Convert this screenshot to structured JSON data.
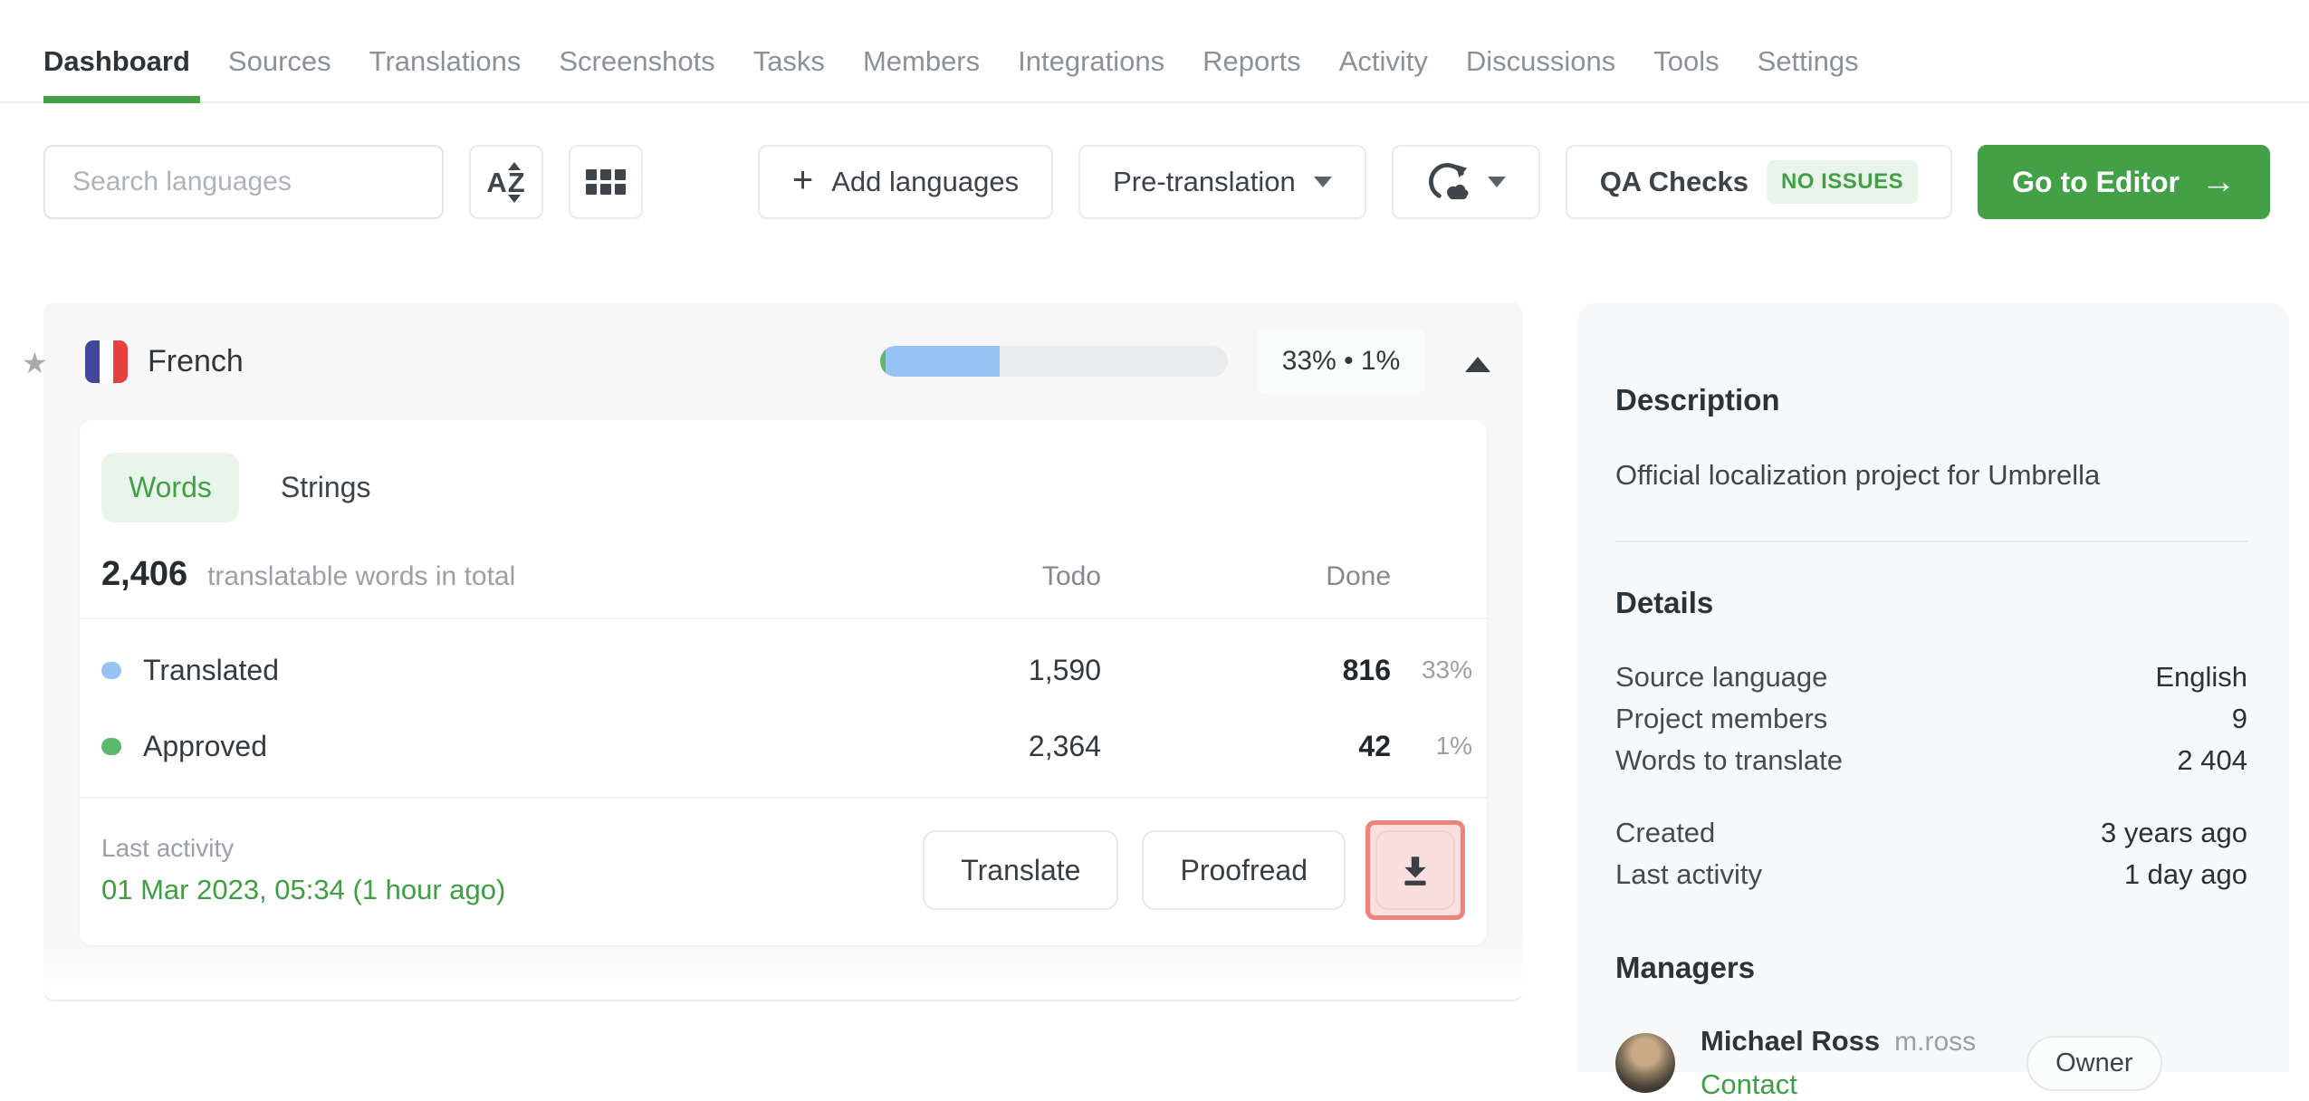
{
  "nav": {
    "items": [
      {
        "label": "Dashboard",
        "active": true
      },
      {
        "label": "Sources"
      },
      {
        "label": "Translations"
      },
      {
        "label": "Screenshots"
      },
      {
        "label": "Tasks"
      },
      {
        "label": "Members"
      },
      {
        "label": "Integrations"
      },
      {
        "label": "Reports"
      },
      {
        "label": "Activity"
      },
      {
        "label": "Discussions"
      },
      {
        "label": "Tools"
      },
      {
        "label": "Settings"
      }
    ]
  },
  "toolbar": {
    "search_placeholder": "Search languages",
    "add_languages_label": "Add languages",
    "pre_translation_label": "Pre-translation",
    "qa_checks_label": "QA Checks",
    "qa_checks_badge": "NO ISSUES",
    "go_to_editor_label": "Go to Editor",
    "go_to_editor_arrow": "→"
  },
  "language": {
    "name": "French",
    "progress_badge": "33% • 1%",
    "translated_percent": 33,
    "approved_percent": 1.5,
    "tabs": {
      "words": "Words",
      "strings": "Strings"
    },
    "total_value": "2,406",
    "total_caption": "translatable words in total",
    "col_todo": "Todo",
    "col_done": "Done",
    "rows": [
      {
        "label": "Translated",
        "todo": "1,590",
        "done": "816",
        "percent": "33%"
      },
      {
        "label": "Approved",
        "todo": "2,364",
        "done": "42",
        "percent": "1%"
      }
    ],
    "last_activity_label": "Last activity",
    "last_activity_value": "01 Mar 2023, 05:34 (1 hour ago)",
    "translate_label": "Translate",
    "proofread_label": "Proofread"
  },
  "sidebar": {
    "description_title": "Description",
    "description_text": "Official localization project for Umbrella",
    "details_title": "Details",
    "details_rows": [
      {
        "label": "Source language",
        "value": "English"
      },
      {
        "label": "Project members",
        "value": "9"
      },
      {
        "label": "Words to translate",
        "value": "2 404"
      }
    ],
    "details_rows2": [
      {
        "label": "Created",
        "value": "3 years ago"
      },
      {
        "label": "Last activity",
        "value": "1 day ago"
      }
    ],
    "managers_title": "Managers",
    "manager": {
      "name": "Michael Ross",
      "username": "m.ross",
      "contact_label": "Contact",
      "role": "Owner"
    }
  },
  "colors": {
    "accent": "#43a047",
    "accent_light": "#e9f5ea",
    "translated": "#97c3f4",
    "approved": "#5cb86a",
    "annotation": "#ee837b",
    "annotation_fill": "#fbdede"
  }
}
